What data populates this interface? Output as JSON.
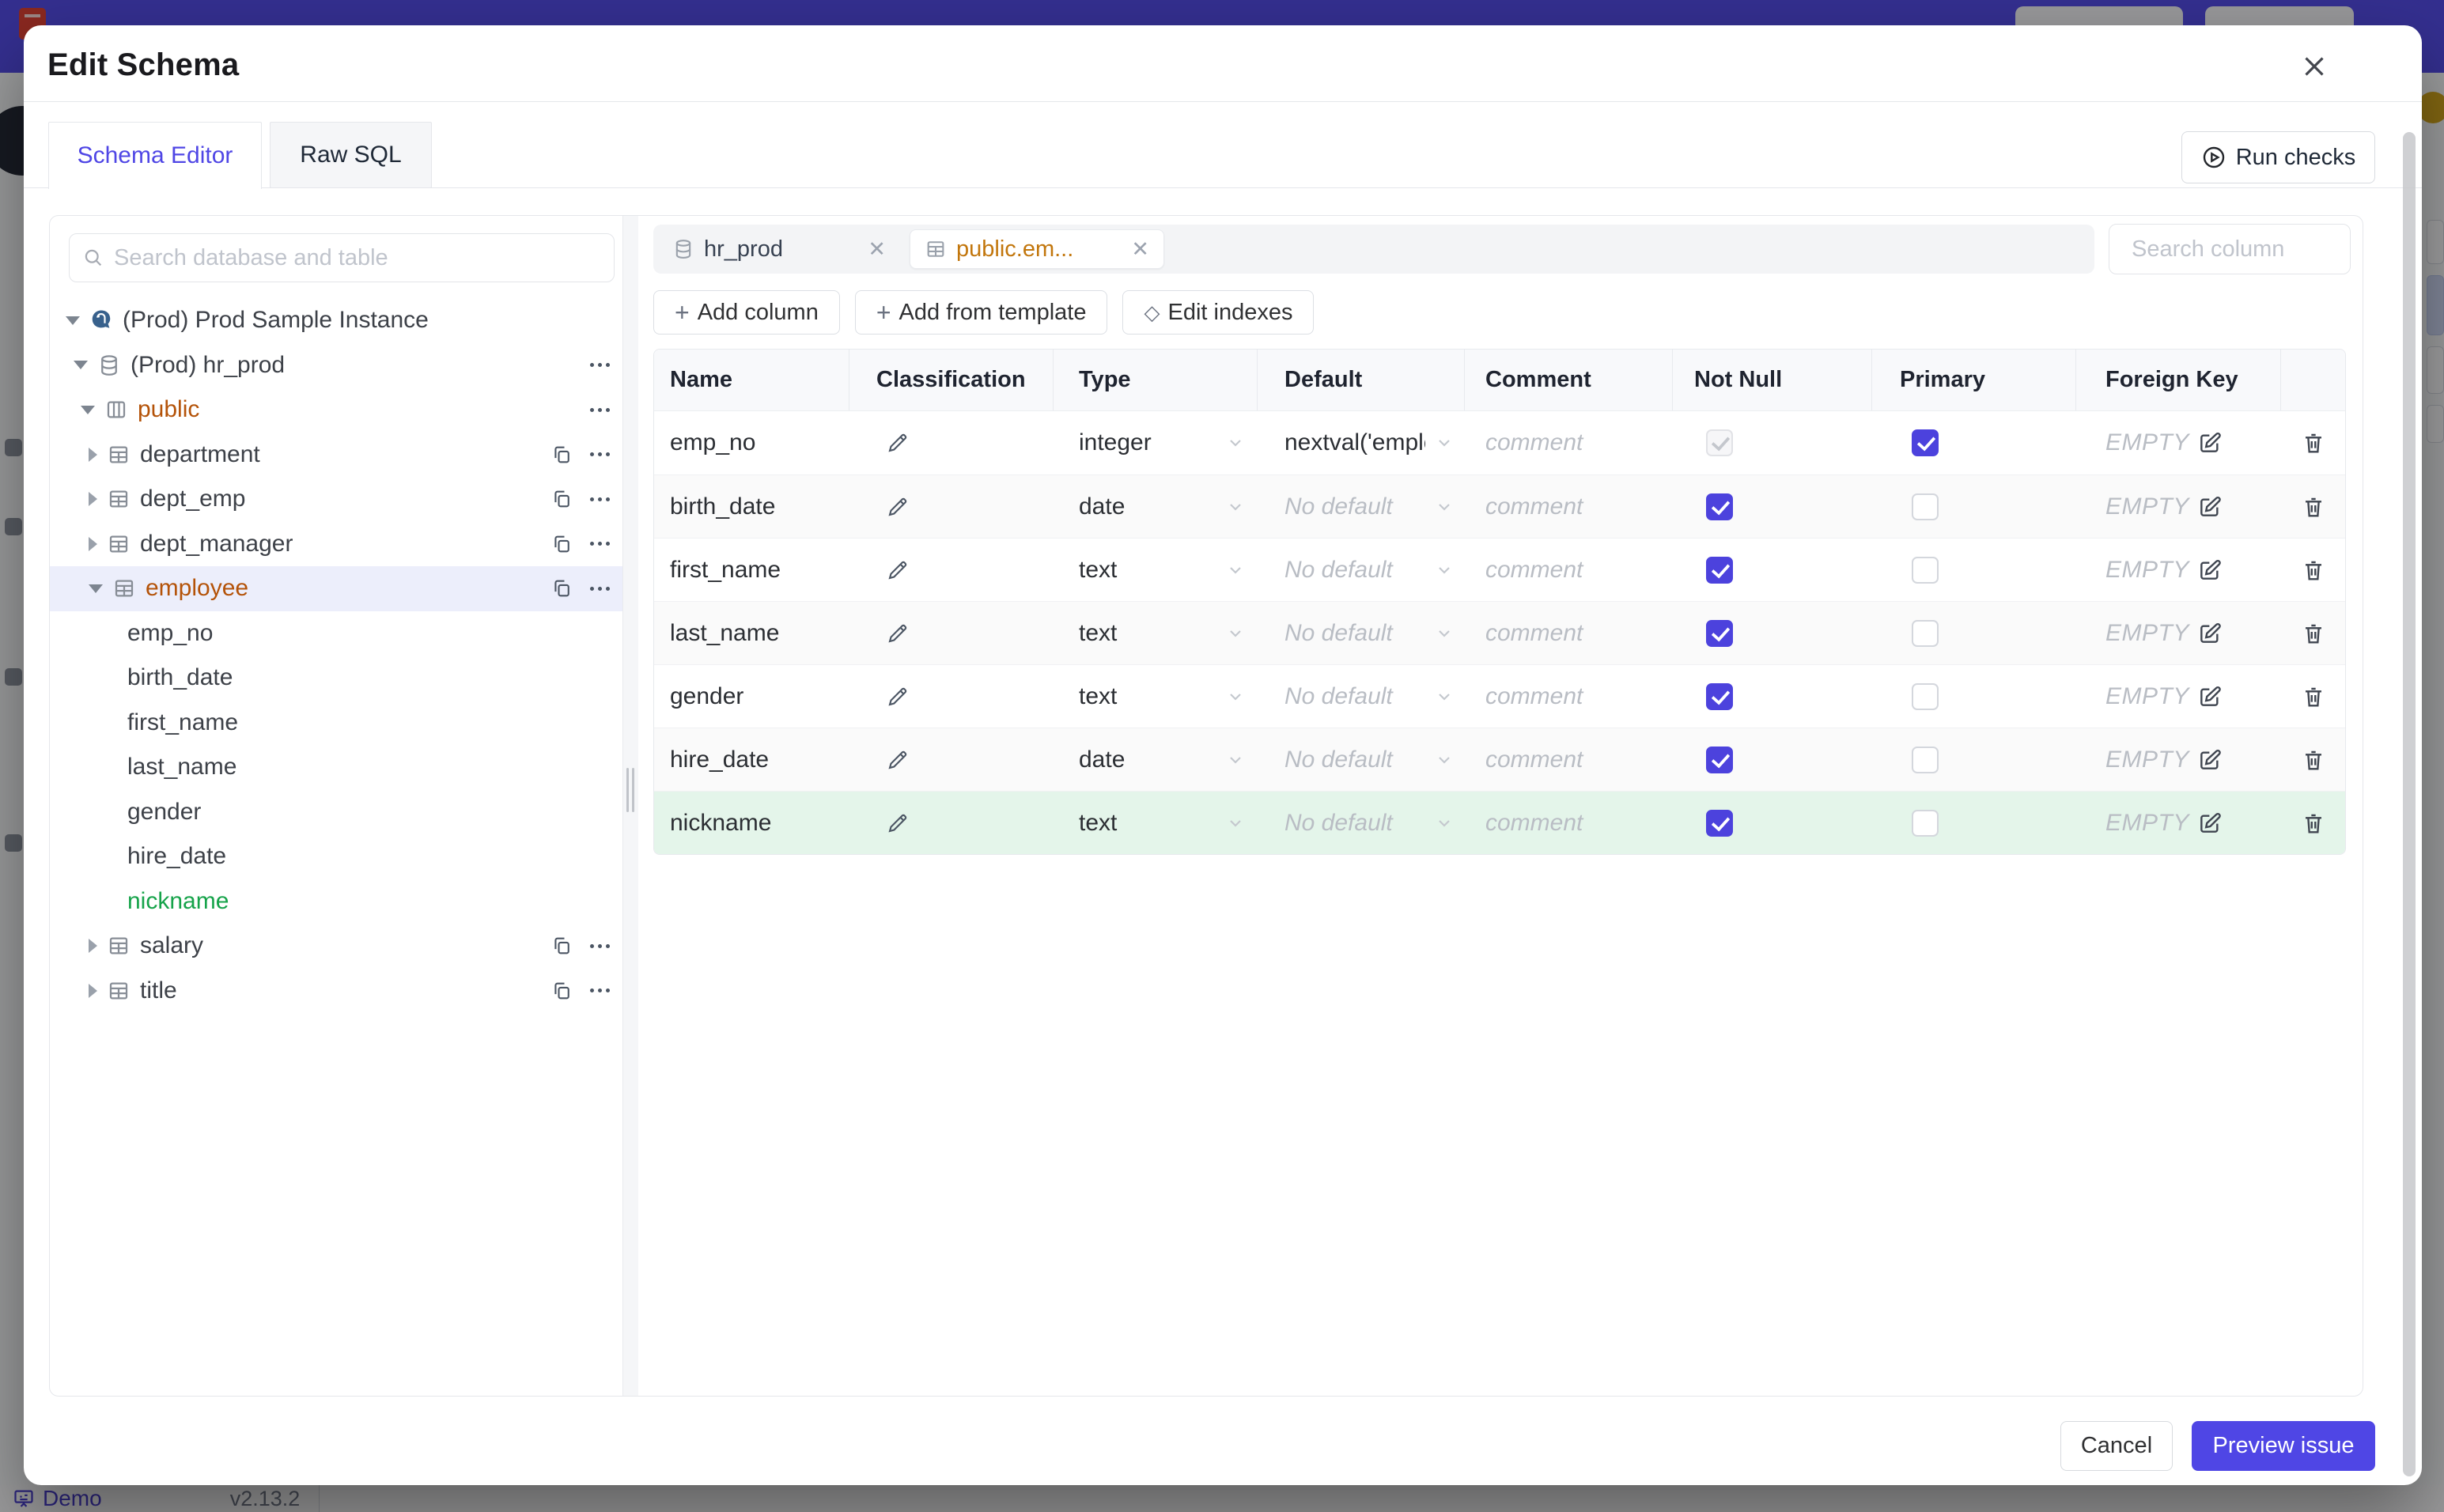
{
  "backdrop": {
    "demo_label": "Demo",
    "version": "v2.13.2"
  },
  "icons": {
    "plus": "+",
    "diamond": "◇",
    "close": "✕"
  },
  "modal": {
    "title": "Edit Schema",
    "tabs": {
      "schema_editor": "Schema Editor",
      "raw_sql": "Raw SQL"
    },
    "run_checks": "Run checks",
    "footer": {
      "cancel": "Cancel",
      "preview_issue": "Preview issue"
    }
  },
  "sidebar": {
    "search_placeholder": "Search database and table",
    "tree": [
      {
        "label": "(Prod) Prod Sample Instance",
        "type": "instance",
        "expanded": true
      },
      {
        "label": "(Prod) hr_prod",
        "type": "database",
        "expanded": true
      },
      {
        "label": "public",
        "type": "schema",
        "expanded": true,
        "status": "changed"
      },
      {
        "label": "department",
        "type": "table",
        "expanded": false
      },
      {
        "label": "dept_emp",
        "type": "table",
        "expanded": false
      },
      {
        "label": "dept_manager",
        "type": "table",
        "expanded": false
      },
      {
        "label": "employee",
        "type": "table",
        "expanded": true,
        "status": "changed",
        "selected": true
      },
      {
        "label": "emp_no",
        "type": "column"
      },
      {
        "label": "birth_date",
        "type": "column"
      },
      {
        "label": "first_name",
        "type": "column"
      },
      {
        "label": "last_name",
        "type": "column"
      },
      {
        "label": "gender",
        "type": "column"
      },
      {
        "label": "hire_date",
        "type": "column"
      },
      {
        "label": "nickname",
        "type": "column",
        "status": "created"
      },
      {
        "label": "salary",
        "type": "table",
        "expanded": false
      },
      {
        "label": "title",
        "type": "table",
        "expanded": false
      }
    ]
  },
  "editor": {
    "tabs": [
      {
        "label": "hr_prod",
        "kind": "database",
        "active": false
      },
      {
        "label": "public.em...",
        "kind": "table",
        "active": true
      }
    ],
    "column_search_placeholder": "Search column",
    "toolbar": {
      "add_column": "Add column",
      "add_from_template": "Add from template",
      "edit_indexes": "Edit indexes"
    },
    "table": {
      "headers": [
        "Name",
        "Classification",
        "Type",
        "Default",
        "Comment",
        "Not Null",
        "Primary",
        "Foreign Key"
      ],
      "no_default": "No default",
      "comment_placeholder": "comment",
      "fk_placeholder": "EMPTY",
      "rows": [
        {
          "name": "emp_no",
          "type": "integer",
          "default": "nextval('employ",
          "not_null": true,
          "not_null_disabled": true,
          "primary": true,
          "status": "normal"
        },
        {
          "name": "birth_date",
          "type": "date",
          "default": null,
          "not_null": true,
          "not_null_disabled": false,
          "primary": false,
          "status": "normal"
        },
        {
          "name": "first_name",
          "type": "text",
          "default": null,
          "not_null": true,
          "not_null_disabled": false,
          "primary": false,
          "status": "normal"
        },
        {
          "name": "last_name",
          "type": "text",
          "default": null,
          "not_null": true,
          "not_null_disabled": false,
          "primary": false,
          "status": "normal"
        },
        {
          "name": "gender",
          "type": "text",
          "default": null,
          "not_null": true,
          "not_null_disabled": false,
          "primary": false,
          "status": "normal"
        },
        {
          "name": "hire_date",
          "type": "date",
          "default": null,
          "not_null": true,
          "not_null_disabled": false,
          "primary": false,
          "status": "normal"
        },
        {
          "name": "nickname",
          "type": "text",
          "default": null,
          "not_null": true,
          "not_null_disabled": false,
          "primary": false,
          "status": "created"
        }
      ]
    }
  },
  "colors": {
    "accent": "#4f46e5",
    "changed": "#b45309",
    "created": "#16a34a",
    "selected_row": "#eceefb",
    "created_row": "#e4f5ea"
  }
}
